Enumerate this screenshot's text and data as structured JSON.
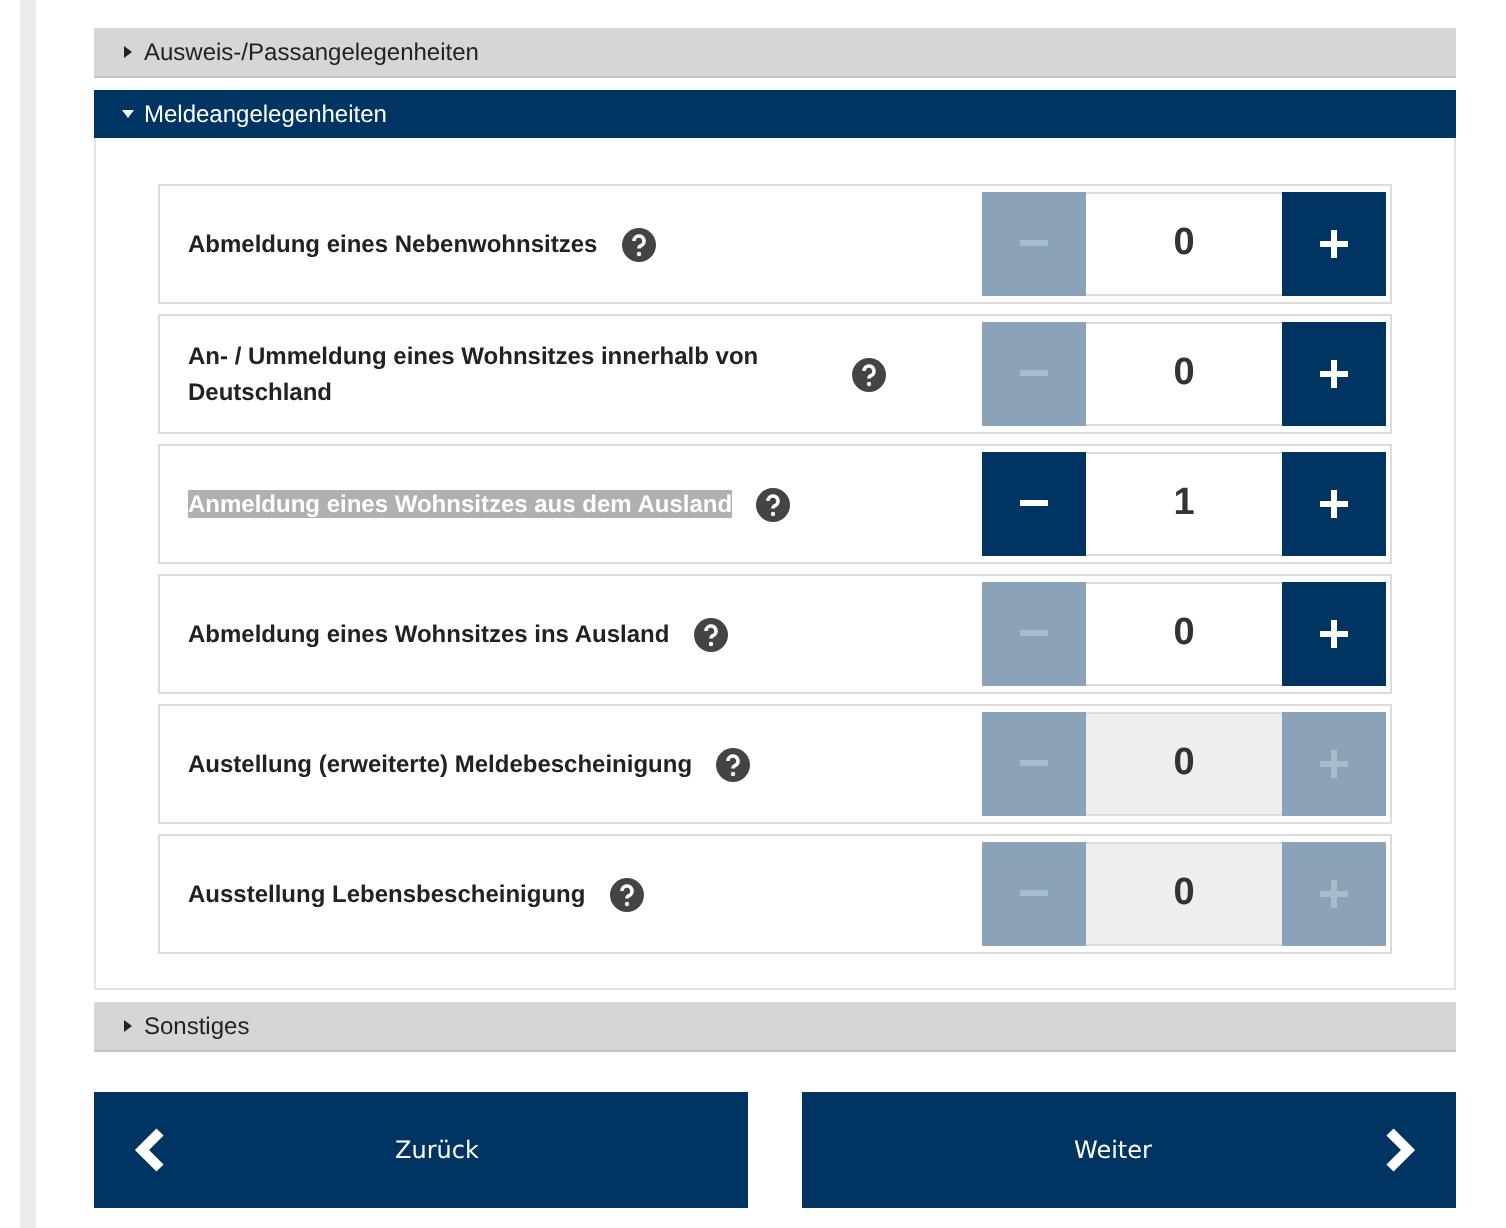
{
  "sections": [
    {
      "title": "Ausweis-/Passangelegenheiten",
      "expanded": false
    },
    {
      "title": "Meldeangelegenheiten",
      "expanded": true,
      "items": [
        {
          "label": "Abmeldung eines Nebenwohnsitzes",
          "value": "0",
          "minus_disabled": true,
          "plus_disabled": false,
          "highlighted": false
        },
        {
          "label": "An- / Ummeldung eines Wohnsitzes innerhalb von Deutschland",
          "value": "0",
          "minus_disabled": true,
          "plus_disabled": false,
          "highlighted": false
        },
        {
          "label": "Anmeldung eines Wohnsitzes aus dem Ausland",
          "value": "1",
          "minus_disabled": false,
          "plus_disabled": false,
          "highlighted": true
        },
        {
          "label": "Abmeldung eines Wohnsitzes ins Ausland",
          "value": "0",
          "minus_disabled": true,
          "plus_disabled": false,
          "highlighted": false
        },
        {
          "label": "Austellung (erweiterte) Meldebescheinigung",
          "value": "0",
          "minus_disabled": true,
          "plus_disabled": true,
          "highlighted": false
        },
        {
          "label": "Ausstellung Lebensbescheinigung",
          "value": "0",
          "minus_disabled": true,
          "plus_disabled": true,
          "highlighted": false
        }
      ]
    },
    {
      "title": "Sonstiges",
      "expanded": false
    }
  ],
  "buttons": [
    {
      "label": "Zurück",
      "kind": "back"
    },
    {
      "label": "Weiter",
      "kind": "next"
    }
  ]
}
